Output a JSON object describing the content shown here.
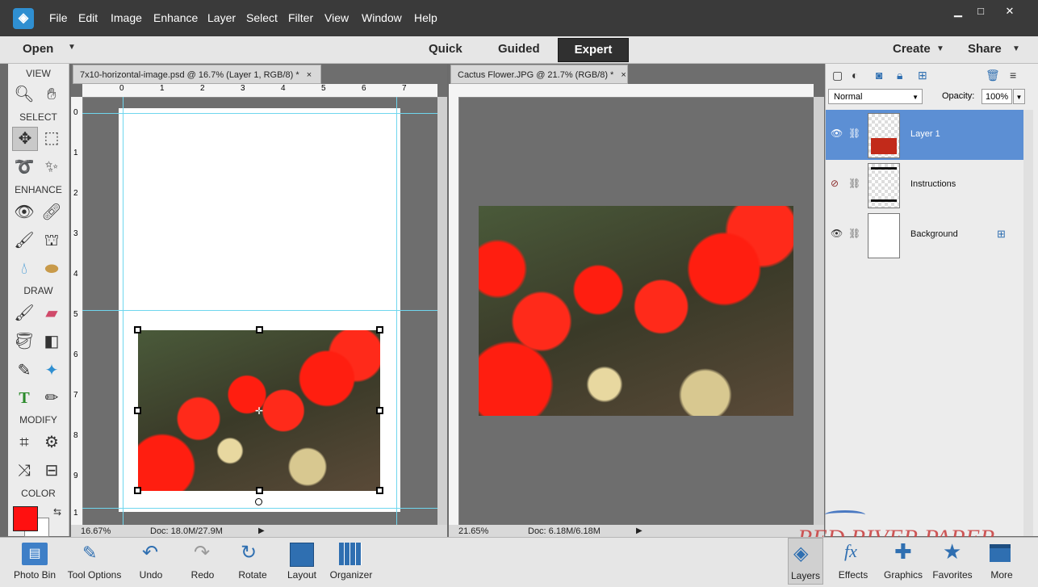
{
  "menubar": {
    "items": [
      "File",
      "Edit",
      "Image",
      "Enhance",
      "Layer",
      "Select",
      "Filter",
      "View",
      "Window",
      "Help"
    ]
  },
  "window_controls": {
    "minimize": "▁",
    "maximize": "□",
    "close": "✕"
  },
  "modebar": {
    "open": "Open",
    "quick": "Quick",
    "guided": "Guided",
    "expert": "Expert",
    "create": "Create",
    "share": "Share"
  },
  "toolbox": {
    "view": "VIEW",
    "select": "SELECT",
    "enhance": "ENHANCE",
    "draw": "DRAW",
    "modify": "MODIFY",
    "color": "COLOR"
  },
  "colors": {
    "foreground": "#ff1010",
    "background": "#ffffff"
  },
  "doc1": {
    "tab": "7x10-horizontal-image.psd @ 16.7% (Layer 1, RGB/8) *",
    "zoom": "16.67%",
    "docsize": "Doc: 18.0M/27.9M",
    "hruler": [
      "0",
      "1",
      "2",
      "3",
      "4",
      "5",
      "6",
      "7"
    ],
    "vruler": [
      "0",
      "1",
      "2",
      "3",
      "4",
      "5",
      "6",
      "7",
      "8",
      "9",
      "1"
    ]
  },
  "doc2": {
    "tab": "Cactus Flower.JPG @ 21.7% (RGB/8) *",
    "zoom": "21.65%",
    "docsize": "Doc: 6.18M/6.18M"
  },
  "layers": {
    "blend_mode": "Normal",
    "opacity_label": "Opacity:",
    "opacity": "100%",
    "items": [
      {
        "name": "Layer 1"
      },
      {
        "name": "Instructions"
      },
      {
        "name": "Background"
      }
    ]
  },
  "bottombar": {
    "items": [
      "Photo Bin",
      "Tool Options",
      "Undo",
      "Redo",
      "Rotate",
      "Layout",
      "Organizer",
      "Layers",
      "Effects",
      "Graphics",
      "Favorites",
      "More"
    ]
  },
  "watermark": "RED RIVER PAPER"
}
